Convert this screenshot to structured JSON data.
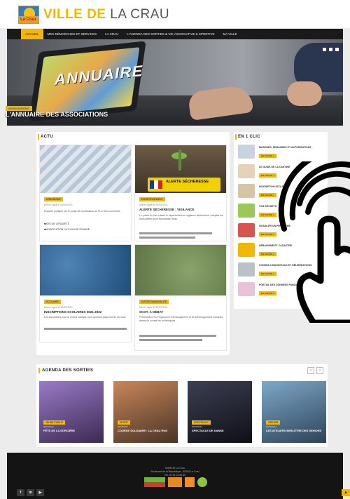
{
  "site": {
    "logo_text": "La Crau",
    "title_bold": "VILLE DE",
    "title_thin": "LA CRAU"
  },
  "nav": {
    "items": [
      {
        "label": "Accueil",
        "active": true
      },
      {
        "label": "Mes démarches et services",
        "active": false
      },
      {
        "label": "La Crau",
        "active": false
      },
      {
        "label": "L'agenda des sorties & Vie associative & Sportive",
        "active": false
      },
      {
        "label": "Ma ville",
        "active": false
      }
    ]
  },
  "hero": {
    "tag": "Associations",
    "title": "L'annuaire des associations",
    "tablet_word": "ANNUAIRE"
  },
  "actu": {
    "title": "Actu",
    "cards": [
      {
        "tag": "Urbanisme",
        "date": "Mis en ligne le 00/00/2021",
        "text": "Enquête publique sur le projet de modification du PLU de la commune.",
        "links": [
          "Avis de l'enquête",
          "Modification du plan de zonage"
        ]
      },
      {
        "tag": "Environnement",
        "date": "Mis en ligne le 00/00/2021",
        "title": "Alerte sécheresse : vigilance",
        "text": "Le préfet du Var a placé le département en vigilance sécheresse. Adoptez les bons gestes pour économiser l'eau.",
        "alert": "Alerte sécheresse"
      },
      {
        "tag": "Scolaire",
        "date": "Mis en ligne le 00/00/2021",
        "title": "Inscriptions scolaires 2021-2022",
        "text": "Les inscriptions pour la rentrée scolaire sont ouvertes jusqu'à la fin du mois."
      },
      {
        "tag": "Intercommunalité",
        "date": "Mis en ligne le 00/00/2021",
        "title": "Scot, à débat",
        "text": "Présentation du Programme d'Aménagement et de Développement Durables devant le conseil de la Métropole."
      }
    ]
  },
  "clic": {
    "title": "En 1 clic",
    "button_label": "En savoir +",
    "items": [
      {
        "label": "Marchés, demandes et autorisations"
      },
      {
        "label": "Le guide de la cantine"
      },
      {
        "label": "Inscription école"
      },
      {
        "label": "Vos déchets"
      },
      {
        "label": "Signaler un problème"
      },
      {
        "label": "Urbanisme et cadastre"
      },
      {
        "label": "Conseils municipaux et délibérations"
      },
      {
        "label": "Portail des données publiques"
      }
    ]
  },
  "agenda": {
    "title": "Agenda des sorties",
    "prev": "‹",
    "next": "›",
    "events": [
      {
        "tag": "Jeune public",
        "date": "00/00/2021",
        "title": "Fête de la sorcière"
      },
      {
        "tag": "Sport",
        "date": "00/00/2021",
        "title": "Course solidaire : la crau run"
      },
      {
        "tag": "Spectacle",
        "date": "00/00/2021",
        "title": "Spectacle de danse"
      },
      {
        "tag": "Atelier",
        "date": "00/00/2021",
        "title": "Les ateliers bien-être des seniors"
      }
    ]
  },
  "footer": {
    "line1": "Mairie de La Crau",
    "line2": "Boulevard de la République - 83260 La Crau",
    "line3": "Tél. 04 94 01 56 80",
    "social": [
      "f",
      "in",
      "▶"
    ],
    "to_top": "▲"
  },
  "colors": {
    "accent": "#f2b705",
    "nav_bg": "#1a1a1a",
    "footer_bg": "#141414"
  }
}
